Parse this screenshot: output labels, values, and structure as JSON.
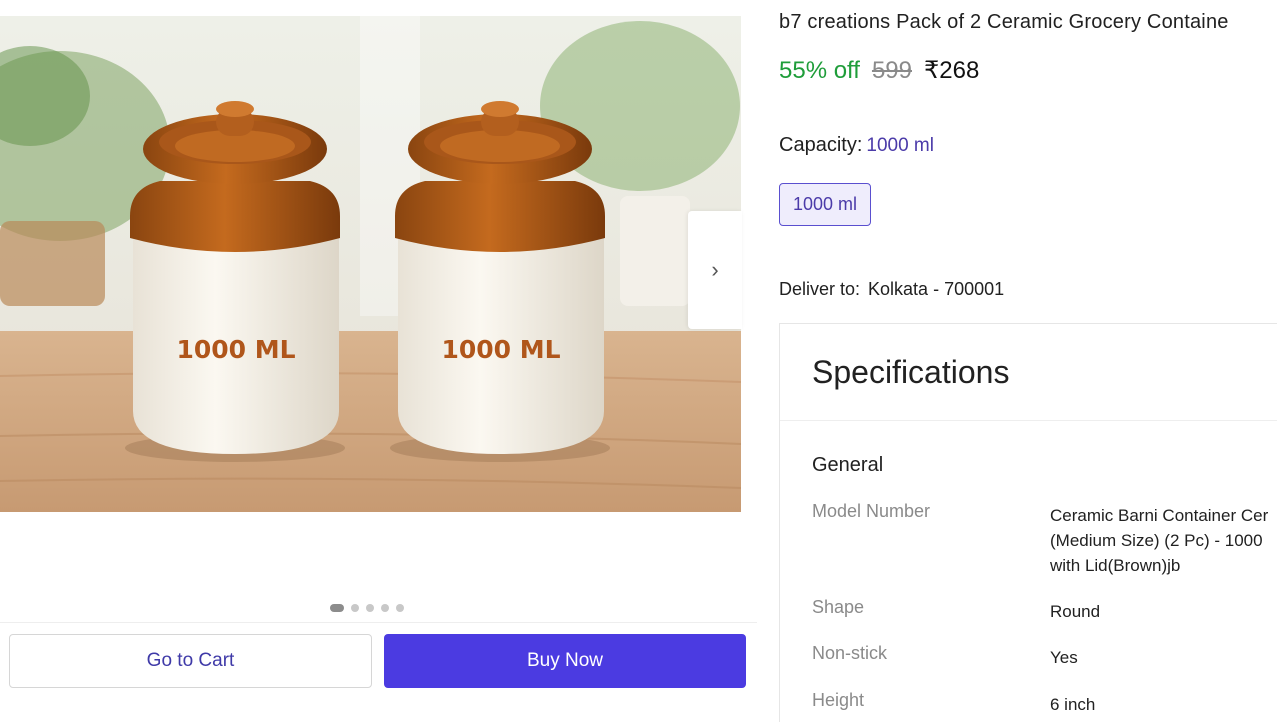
{
  "product": {
    "title": "b7 creations Pack of 2 Ceramic Grocery Containe",
    "discount": "55% off",
    "mrp": "599",
    "price": "₹268",
    "image_label_left": "1000 ML",
    "image_label_right": "1000 ML"
  },
  "gallery": {
    "next_icon": "chevron-right-icon",
    "dot_count": 5,
    "active_dot": 0
  },
  "capacity": {
    "label": "Capacity:",
    "selected": "1000 ml",
    "option": "1000 ml"
  },
  "delivery": {
    "label": "Deliver to:",
    "location": "Kolkata - 700001"
  },
  "actions": {
    "cart_label": "Go to Cart",
    "buy_label": "Buy Now"
  },
  "specifications": {
    "heading": "Specifications",
    "section": "General",
    "rows": [
      {
        "key": "Model Number",
        "lines": [
          "Ceramic Barni Container Cer",
          "(Medium Size) (2 Pc) - 1000",
          "with Lid(Brown)jb"
        ]
      },
      {
        "key": "Shape",
        "lines": [
          "Round"
        ]
      },
      {
        "key": "Non-stick",
        "lines": [
          "Yes"
        ]
      },
      {
        "key": "Height",
        "lines": [
          "6 inch"
        ]
      }
    ]
  },
  "colors": {
    "discount_green": "#1f9d3a",
    "buy_button": "#4b3be1",
    "accent_purple": "#4b3ba9"
  }
}
